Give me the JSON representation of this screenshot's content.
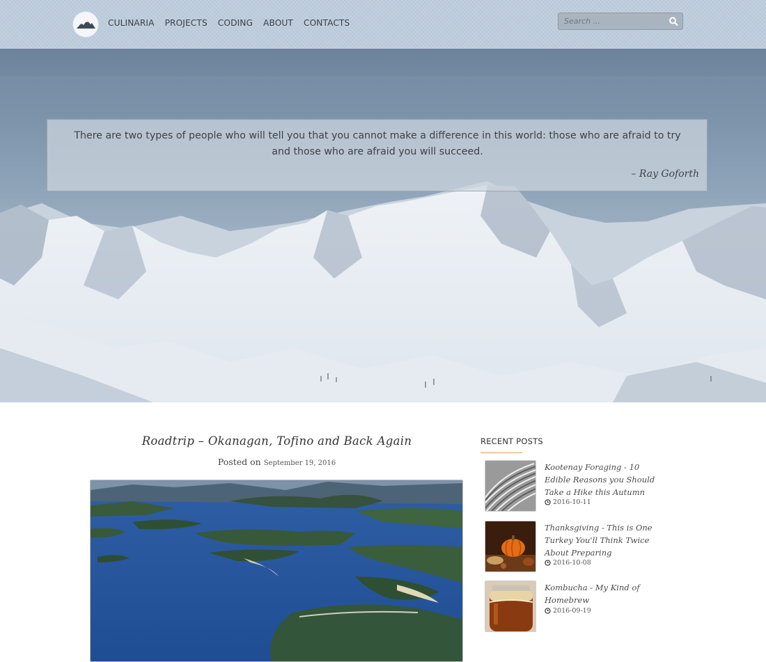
{
  "nav": {
    "items": [
      {
        "label": "CULINARIA"
      },
      {
        "label": "PROJECTS"
      },
      {
        "label": "CODING"
      },
      {
        "label": "ABOUT"
      },
      {
        "label": "CONTACTS"
      }
    ]
  },
  "search": {
    "placeholder": "Search ..."
  },
  "hero": {
    "quote": "There are two types of people who will tell you that you cannot make a difference in this world: those who are afraid to try and those who are afraid you will succeed.",
    "author": "– Ray Goforth"
  },
  "post": {
    "title": "Roadtrip – Okanagan, Tofino and Back Again",
    "posted_on": "Posted on",
    "date": "September 19, 2016"
  },
  "sidebar": {
    "heading": "RECENT POSTS",
    "posts": [
      {
        "title": "Kootenay Foraging - 10 Edible Reasons you Should Take a Hike this Autumn",
        "date": "2016-10-11"
      },
      {
        "title": "Thanksgiving - This is One Turkey You'll Think Twice About Preparing",
        "date": "2016-10-08"
      },
      {
        "title": "Kombucha - My Kind of Homebrew",
        "date": "2016-09-19"
      }
    ]
  },
  "colors": {
    "accent_underline": "#e0a55a",
    "header_bg": "#bdccdc"
  }
}
